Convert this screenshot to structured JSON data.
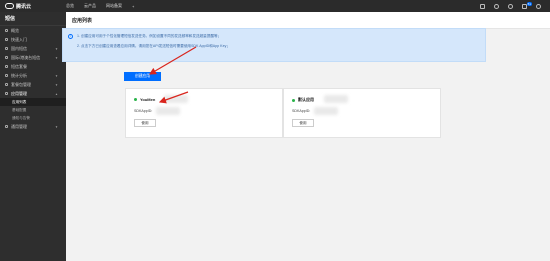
{
  "topbar": {
    "brand": "腾讯云",
    "nav": [
      "总览",
      "云产品",
      "网站备案"
    ],
    "plus": "+",
    "badge": "51"
  },
  "sidebar": {
    "title": "短信",
    "items": [
      {
        "label": "概览",
        "has_caret": false
      },
      {
        "label": "快速入门",
        "has_caret": false
      },
      {
        "label": "国内短信",
        "has_caret": true
      },
      {
        "label": "国际/港澳台短信",
        "has_caret": true
      },
      {
        "label": "短信套餐",
        "has_caret": false
      },
      {
        "label": "统计分析",
        "has_caret": true
      },
      {
        "label": "套餐包管理",
        "has_caret": true
      },
      {
        "label": "应用管理",
        "has_caret": true,
        "open": true
      },
      {
        "label": "通用管理",
        "has_caret": true
      }
    ],
    "app_sub": [
      "应用列表",
      "基础配置",
      "通知与告警"
    ],
    "active_sub": "应用列表"
  },
  "page": {
    "title": "应用列表"
  },
  "notice": {
    "icon": "info-icon",
    "line1": "1. 创建应用可用于个性化管理短信发送任务。例如设置不同的发送频率和发送超量提醒等；",
    "line2": "2. 点击下方已创建应用查看应用详情。请用您在API发送短信时需要使用SDK AppID和App Key；"
  },
  "create_button": "创建应用",
  "apps": [
    {
      "name": "YouMen",
      "sdk_label": "SDKAppID:",
      "action": "使用",
      "status_color": "#2bb34a"
    },
    {
      "name": "默认应用",
      "sdk_label": "SDKAppID:",
      "action": "使用",
      "status_color": "#2bb34a"
    }
  ],
  "colors": {
    "accent": "#006eff",
    "topbar": "#2b2b2b",
    "sidebar": "#2e2e2e",
    "notice_bg": "#d5e7fb",
    "annotation_arrow": "#d9251d"
  }
}
